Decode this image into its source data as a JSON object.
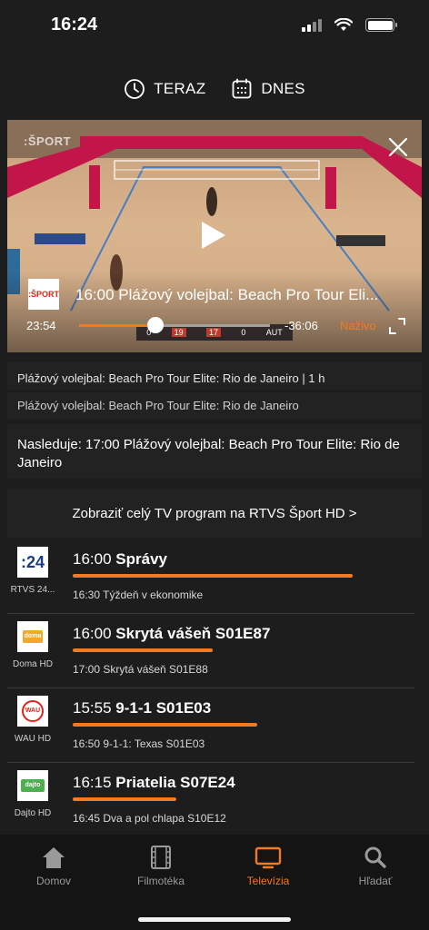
{
  "status_bar": {
    "time": "16:24"
  },
  "top_nav": {
    "now_label": "TERAZ",
    "today_label": "DNES"
  },
  "player": {
    "channel_watermark": ":ŠPORT",
    "logo_text": ":ŠPORT",
    "title": "16:00 Plážový volejbal: Beach Pro Tour Eli...",
    "elapsed": "23:54",
    "remaining": "-36:06",
    "live_label": "Naživo",
    "progress_fraction": 0.4,
    "scoreboard": {
      "left": "0",
      "score_a": "19",
      "score_b": "17",
      "right": "0",
      "team": "AUT"
    }
  },
  "info": {
    "line1": "Plážový volejbal: Beach Pro Tour Elite: Rio de Janeiro | 1 h",
    "line2": "Plážový volejbal: Beach Pro Tour Elite: Rio de Janeiro",
    "next": "Nasleduje: 17:00 Plážový volejbal: Beach Pro Tour Elite: Rio de Janeiro",
    "full_program_link": "Zobraziť celý TV program na RTVS Šport HD >"
  },
  "channels": [
    {
      "name": "RTVS 24...",
      "logo": ":24",
      "now_time": "16:00",
      "now_title": "Správy",
      "progress_fraction": 1.0,
      "next": "16:30  Týždeň v ekonomike"
    },
    {
      "name": "Doma HD",
      "logo": "doma",
      "now_time": "16:00",
      "now_title": "Skrytá vášeň S01E87",
      "progress_fraction": 0.5,
      "next": "17:00  Skrytá vášeň S01E88"
    },
    {
      "name": "WAU HD",
      "logo": "WAU",
      "now_time": "15:55",
      "now_title": "9-1-1 S01E03",
      "progress_fraction": 0.66,
      "next": "16:50  9-1-1: Texas S01E03"
    },
    {
      "name": "Dajto HD",
      "logo": "dajto",
      "now_time": "16:15",
      "now_title": "Priatelia S07E24",
      "progress_fraction": 0.37,
      "next": "16:45  Dva a pol chlapa S10E12"
    }
  ],
  "tabs": [
    {
      "label": "Domov",
      "icon": "home-icon",
      "active": false
    },
    {
      "label": "Filmotéka",
      "icon": "film-icon",
      "active": false
    },
    {
      "label": "Televízia",
      "icon": "tv-icon",
      "active": true
    },
    {
      "label": "Hľadať",
      "icon": "search-icon",
      "active": false
    }
  ],
  "colors": {
    "accent": "#f47a1f",
    "background": "#1d1d1d",
    "tab_bar": "#141414"
  }
}
